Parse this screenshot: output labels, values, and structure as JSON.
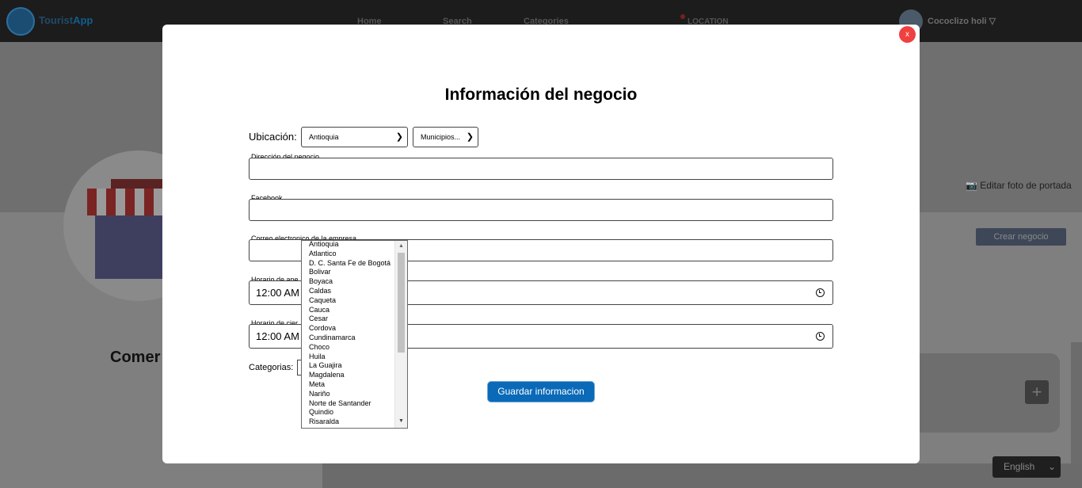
{
  "navbar": {
    "logo_text_a": "Tourist",
    "logo_text_b": "App",
    "links": [
      "Home",
      "Search",
      "Categories"
    ],
    "location": "LOCATION",
    "user": "Cococlizo holi ▽"
  },
  "background": {
    "edit_cover": "Editar foto de portada",
    "create_business": "Crear negocio",
    "heading_partial": "Comer",
    "plus": "+",
    "language": "English"
  },
  "modal": {
    "close": "x",
    "title": "Información del negocio",
    "location_label": "Ubicación:",
    "department_selected": "Antioquia",
    "municipality_selected": "Municipios...",
    "address_label": "Dirección del negocio",
    "facebook_label": "Facebook",
    "email_label": "Correo electronico de la empresa",
    "open_label": "Horario de ape",
    "open_value": "12:00 AM",
    "close_label": "Horario de cier",
    "close_value": "12:00 AM",
    "categories_label": "Categorias:",
    "save_button": "Guardar informacion"
  },
  "dropdown": {
    "options": [
      "Antioquia",
      "Atlantico",
      "D. C. Santa Fe de Bogotá",
      "Bolivar",
      "Boyaca",
      "Caldas",
      "Caqueta",
      "Cauca",
      "Cesar",
      "Cordova",
      "Cundinamarca",
      "Choco",
      "Huila",
      "La Guajira",
      "Magdalena",
      "Meta",
      "Nariño",
      "Norte de Santander",
      "Quindio",
      "Risaralda"
    ]
  },
  "icons": {
    "camera": "camera-icon",
    "clock": "clock-icon",
    "chevron": "chevron-down-icon"
  }
}
